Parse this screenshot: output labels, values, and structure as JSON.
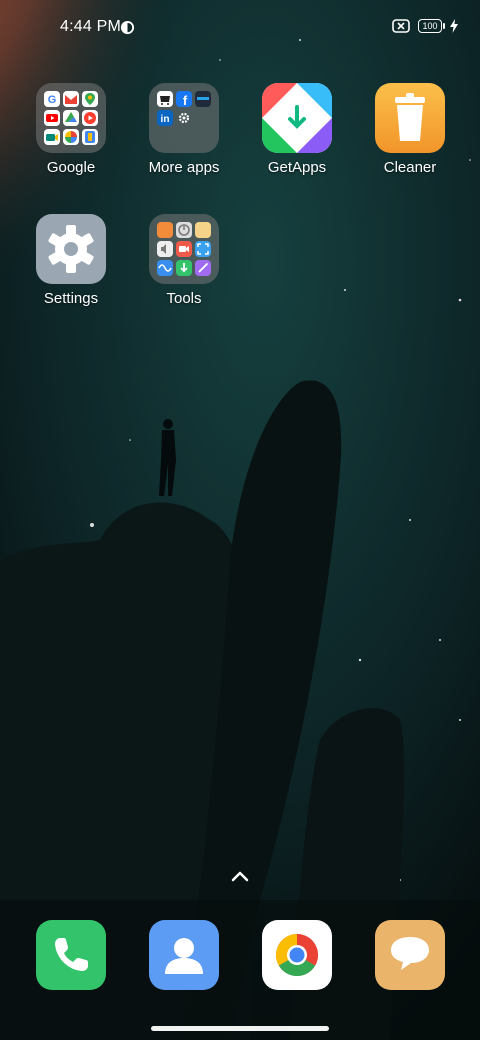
{
  "status_bar": {
    "time": "4:44 PM",
    "battery_level": "100",
    "icons": [
      "circle-status-icon",
      "sim-off-icon",
      "battery-icon",
      "charging-icon"
    ]
  },
  "apps": [
    {
      "label": "Google",
      "type": "folder",
      "icon": "google-folder-icon"
    },
    {
      "label": "More apps",
      "type": "folder",
      "icon": "more-apps-folder-icon"
    },
    {
      "label": "GetApps",
      "type": "app",
      "icon": "getapps-icon"
    },
    {
      "label": "Cleaner",
      "type": "app",
      "icon": "cleaner-icon"
    },
    {
      "label": "Settings",
      "type": "app",
      "icon": "settings-icon"
    },
    {
      "label": "Tools",
      "type": "folder",
      "icon": "tools-folder-icon"
    }
  ],
  "dock": [
    {
      "name": "phone",
      "icon": "phone-icon",
      "color": "#33c36a"
    },
    {
      "name": "contacts",
      "icon": "contacts-icon",
      "color": "#5c9cf5"
    },
    {
      "name": "chrome",
      "icon": "chrome-icon",
      "color": "#ffffff"
    },
    {
      "name": "messages",
      "icon": "message-icon",
      "color": "#eab56b"
    }
  ],
  "colors": {
    "accent": "#33c36a",
    "wallpaper_dark": "#0b1a1b",
    "moon": "#d9dbe2"
  }
}
